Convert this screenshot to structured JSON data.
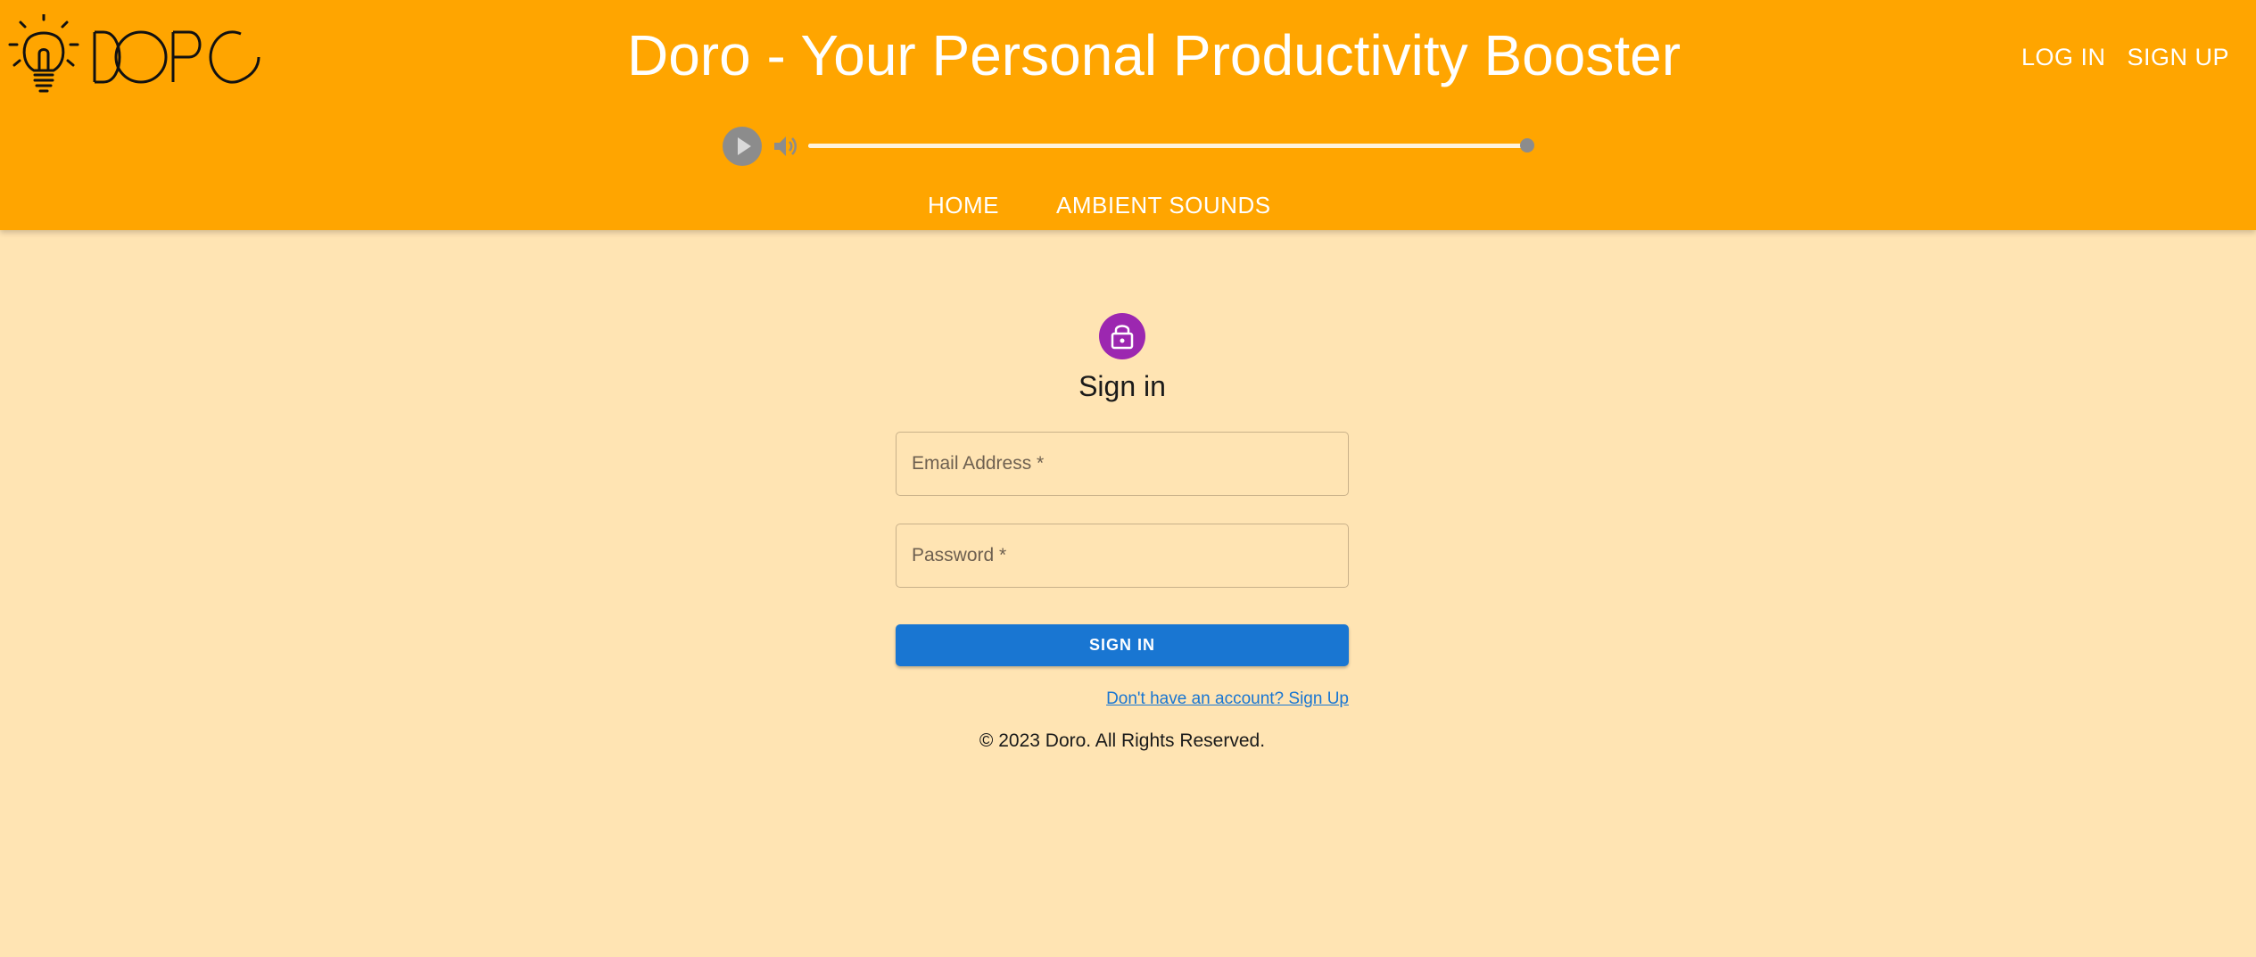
{
  "header": {
    "title": "Doro - Your Personal Productivity Booster",
    "logo_alt": "DORO",
    "auth": {
      "login": "LOG IN",
      "signup": "SIGN UP"
    },
    "player": {
      "progress_percent": 100,
      "play_icon": "play-icon",
      "volume_icon": "volume-icon"
    },
    "nav": [
      {
        "label": "HOME"
      },
      {
        "label": "AMBIENT SOUNDS"
      }
    ]
  },
  "signin": {
    "icon": "lock-icon",
    "heading": "Sign in",
    "email_label": "Email Address *",
    "password_label": "Password *",
    "submit": "SIGN IN",
    "signup_link": "Don't have an account? Sign Up"
  },
  "footer": {
    "copyright": "© 2023 Doro. All Rights Reserved."
  },
  "colors": {
    "header": "#ffa500",
    "background": "#ffe4b3",
    "primary": "#1976d2",
    "avatar": "#9c27b0"
  }
}
